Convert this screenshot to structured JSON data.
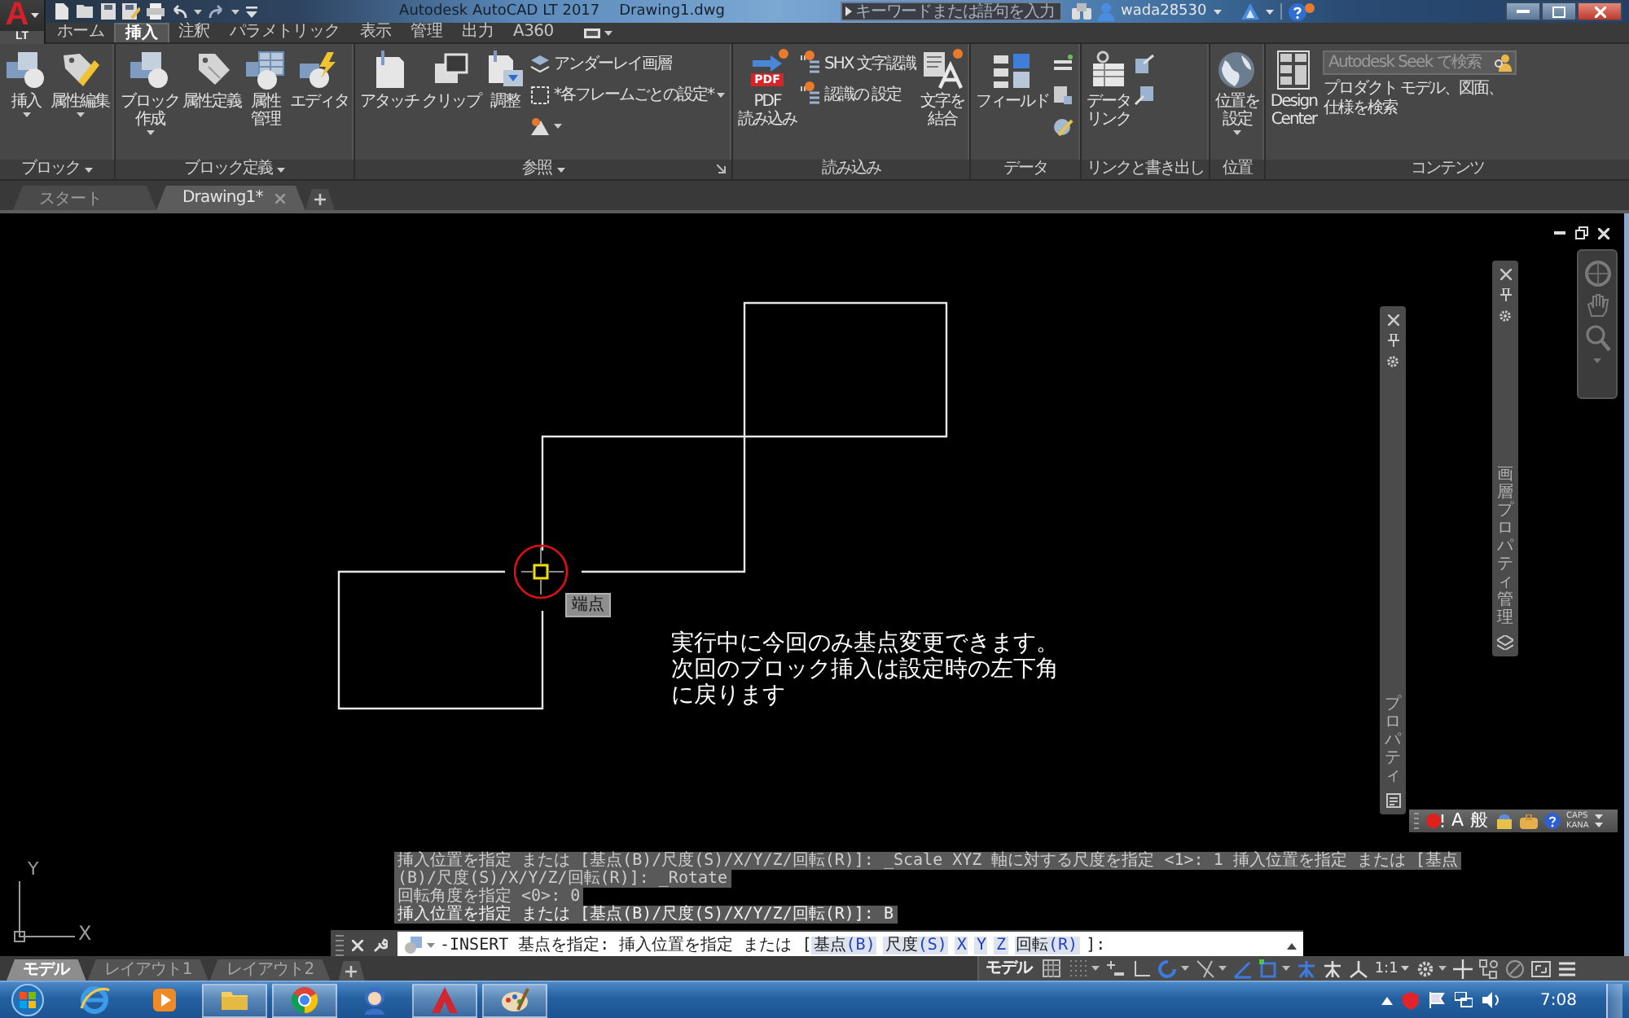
{
  "title_bar": {
    "app_button": {
      "letter": "A",
      "edition": "LT"
    },
    "title": "Autodesk AutoCAD LT 2017",
    "file_name": "Drawing1.dwg",
    "search": {
      "placeholder": "キーワードまたは語句を入力"
    },
    "user": "wada28530",
    "help_badge": true
  },
  "ribbon_tabs": [
    {
      "label": "ホーム",
      "selected": false
    },
    {
      "label": "挿入",
      "selected": true
    },
    {
      "label": "注釈",
      "selected": false
    },
    {
      "label": "パラメトリック",
      "selected": false
    },
    {
      "label": "表示",
      "selected": false
    },
    {
      "label": "管理",
      "selected": false
    },
    {
      "label": "出力",
      "selected": false
    },
    {
      "label": "A360",
      "selected": false
    }
  ],
  "ribbon_panels": [
    {
      "title": "ブロック",
      "menu": true,
      "launcher": false,
      "tools": [
        {
          "kind": "large",
          "lines": [
            "挿入"
          ],
          "menu": true,
          "badge": false
        },
        {
          "kind": "large",
          "lines": [
            "属性編集"
          ],
          "menu": true,
          "badge": false
        }
      ]
    },
    {
      "title": "ブロック定義",
      "menu": true,
      "launcher": false,
      "tools": [
        {
          "kind": "large",
          "lines": [
            "ブロック",
            "作成"
          ],
          "menu": true,
          "badge": false
        },
        {
          "kind": "large",
          "lines": [
            "属性定義"
          ],
          "menu": false,
          "badge": false
        },
        {
          "kind": "large",
          "lines": [
            "属性",
            "管理"
          ],
          "menu": false,
          "badge": false
        },
        {
          "kind": "large",
          "lines": [
            "エディタ"
          ],
          "menu": false,
          "badge": false
        }
      ]
    },
    {
      "title": "参照",
      "menu": true,
      "launcher": true,
      "tools": [
        {
          "kind": "large",
          "lines": [
            "アタッチ"
          ],
          "menu": false,
          "badge": false
        },
        {
          "kind": "large",
          "lines": [
            "クリップ"
          ],
          "menu": false,
          "badge": false
        },
        {
          "kind": "large",
          "lines": [
            "調整"
          ],
          "menu": false,
          "badge": false
        },
        {
          "kind": "small",
          "label": "アンダーレイ画層",
          "menu": false,
          "badge": false
        },
        {
          "kind": "small",
          "label": "*各フレームごとの設定*",
          "menu": true,
          "badge": false
        },
        {
          "kind": "small",
          "menu": true,
          "badge": false
        }
      ]
    },
    {
      "title": "読み込み",
      "menu": false,
      "launcher": false,
      "tools": [
        {
          "kind": "large",
          "lines": [
            "PDF",
            "読み込み"
          ],
          "icon_text": "PDF",
          "menu": false,
          "badge": true
        },
        {
          "kind": "small",
          "label": "SHX 文字認識",
          "menu": false,
          "badge": true
        },
        {
          "kind": "small",
          "label": "認識の 設定",
          "menu": false,
          "badge": true
        },
        {
          "kind": "large",
          "lines": [
            "文字を",
            "結合"
          ],
          "menu": false,
          "badge": true
        }
      ]
    },
    {
      "title": "データ",
      "menu": false,
      "launcher": false,
      "tools": [
        {
          "kind": "large",
          "lines": [
            "フィールド"
          ],
          "menu": false,
          "badge": false
        },
        {
          "kind": "small",
          "menu": false,
          "badge": false
        },
        {
          "kind": "small",
          "menu": false,
          "badge": false
        },
        {
          "kind": "small",
          "menu": false,
          "badge": false
        }
      ]
    },
    {
      "title": "リンクと書き出し",
      "menu": false,
      "launcher": false,
      "tools": [
        {
          "kind": "large",
          "lines": [
            "データ",
            "リンク"
          ],
          "menu": false,
          "badge": false
        },
        {
          "kind": "small",
          "menu": false,
          "badge": false
        },
        {
          "kind": "small",
          "menu": false,
          "badge": false
        }
      ]
    },
    {
      "title": "位置",
      "menu": false,
      "launcher": false,
      "tools": [
        {
          "kind": "large",
          "lines": [
            "位置を",
            "設定"
          ],
          "menu": true,
          "badge": false
        }
      ]
    },
    {
      "title": "コンテンツ",
      "menu": false,
      "launcher": false,
      "tools": [
        {
          "kind": "large",
          "lines": [
            "Design",
            "Center"
          ],
          "menu": false,
          "badge": false
        },
        {
          "kind": "search",
          "placeholder": "Autodesk Seek で検索",
          "caption": "プロダクト モデル、図面、仕様を検索"
        }
      ]
    }
  ],
  "file_tabs": [
    {
      "label": "スタート",
      "selected": false,
      "closable": false
    },
    {
      "label": "Drawing1*",
      "selected": true,
      "closable": true
    }
  ],
  "canvas": {
    "snap_tooltip": "端点",
    "note": "実行中に今回のみ基点変更できます。次回のブロック挿入は設定時の左下角に戻ります",
    "ucs": {
      "y_label": "Y",
      "x_label": "X"
    },
    "palettes": [
      {
        "title": "プロパティ"
      },
      {
        "title": "画層プロパティ管理"
      }
    ],
    "ime_bar": {
      "input_mode": "A",
      "dictionary": "般",
      "caps": "CAPS",
      "kana": "KANA"
    }
  },
  "command_line": {
    "history": [
      "挿入位置を指定 または [基点(B)/尺度(S)/X/Y/Z/回転(R)]: _Scale XYZ 軸に対する尺度を指定 <1>: 1 挿入位置を指定 または [基点",
      "(B)/尺度(S)/X/Y/Z/回転(R)]: _Rotate",
      "回転角度を指定 <0>: 0",
      "挿入位置を指定 または [基点(B)/尺度(S)/X/Y/Z/回転(R)]: B"
    ],
    "prompt": "-INSERT 基点を指定: 挿入位置を指定 または [",
    "options": [
      {
        "label": "基点",
        "key": "(B)"
      },
      {
        "label": "尺度",
        "key": "(S)"
      },
      {
        "key": "X"
      },
      {
        "key": "Y"
      },
      {
        "key": "Z"
      },
      {
        "label": "回転",
        "key": "(R)"
      }
    ],
    "prompt_end": "]:"
  },
  "layout_tabs": [
    {
      "label": "モデル",
      "selected": true
    },
    {
      "label": "レイアウト1",
      "selected": false
    },
    {
      "label": "レイアウト2",
      "selected": false
    }
  ],
  "status_bar": {
    "space": "モデル",
    "annotation_scale": "1:1"
  },
  "taskbar": {
    "apps": [
      {
        "running": false
      },
      {
        "running": false
      },
      {
        "running": true
      },
      {
        "running": true
      },
      {
        "running": false
      },
      {
        "running": true
      },
      {
        "running": true
      }
    ],
    "clock": "7:08"
  }
}
